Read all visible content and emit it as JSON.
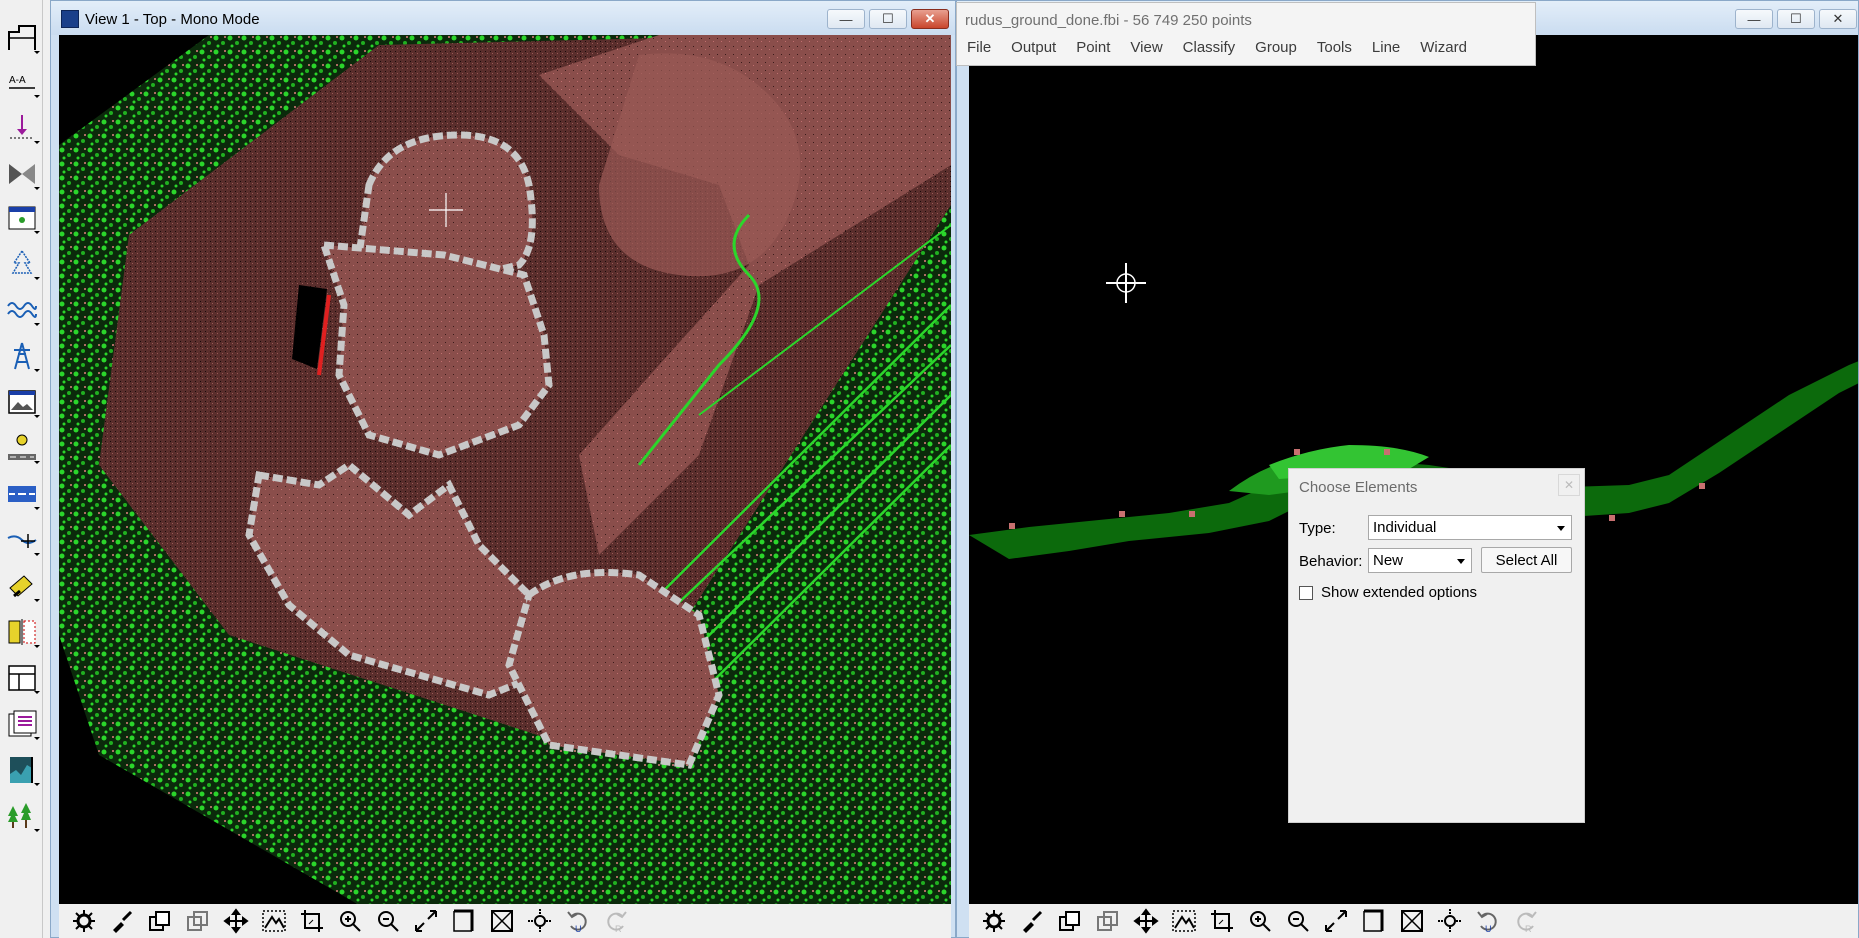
{
  "left_toolbar": {
    "tools": [
      "draw-tool-icon",
      "section-tool-icon",
      "point-tool-icon",
      "model-tool-icon",
      "view-tool-icon",
      "tree-tool-icon",
      "wave-tool-icon",
      "tower-tool-icon",
      "image-tool-icon",
      "road-tool-icon",
      "lane-tool-icon",
      "line-tool-icon",
      "paint-tool-icon",
      "compare-tool-icon",
      "layout-tool-icon",
      "report-tool-icon",
      "profile-tool-icon",
      "forest-tool-icon"
    ]
  },
  "view1": {
    "title": "View 1 - Top - Mono Mode",
    "controls": {
      "minimize": "—",
      "maximize": "☐",
      "close": "✕"
    }
  },
  "view2": {
    "controls": {
      "minimize": "—",
      "maximize": "☐",
      "close": "✕"
    }
  },
  "app_menu": {
    "file_title": "rudus_ground_done.fbi - 56 749 250 points",
    "items": [
      "File",
      "Output",
      "Point",
      "View",
      "Classify",
      "Group",
      "Tools",
      "Line",
      "Wizard"
    ]
  },
  "dialog": {
    "title": "Choose Elements",
    "type_label": "Type:",
    "type_value": "Individual",
    "behavior_label": "Behavior:",
    "behavior_value": "New",
    "select_all_label": "Select All",
    "extended_label": "Show extended options",
    "extended_checked": false
  },
  "colors": {
    "ground": "#8a4e4b",
    "vegetation": "#2bd62b",
    "boundary": "#c8c8c8",
    "highlight_red": "#e02020",
    "title_bar": "#cadcf0"
  }
}
